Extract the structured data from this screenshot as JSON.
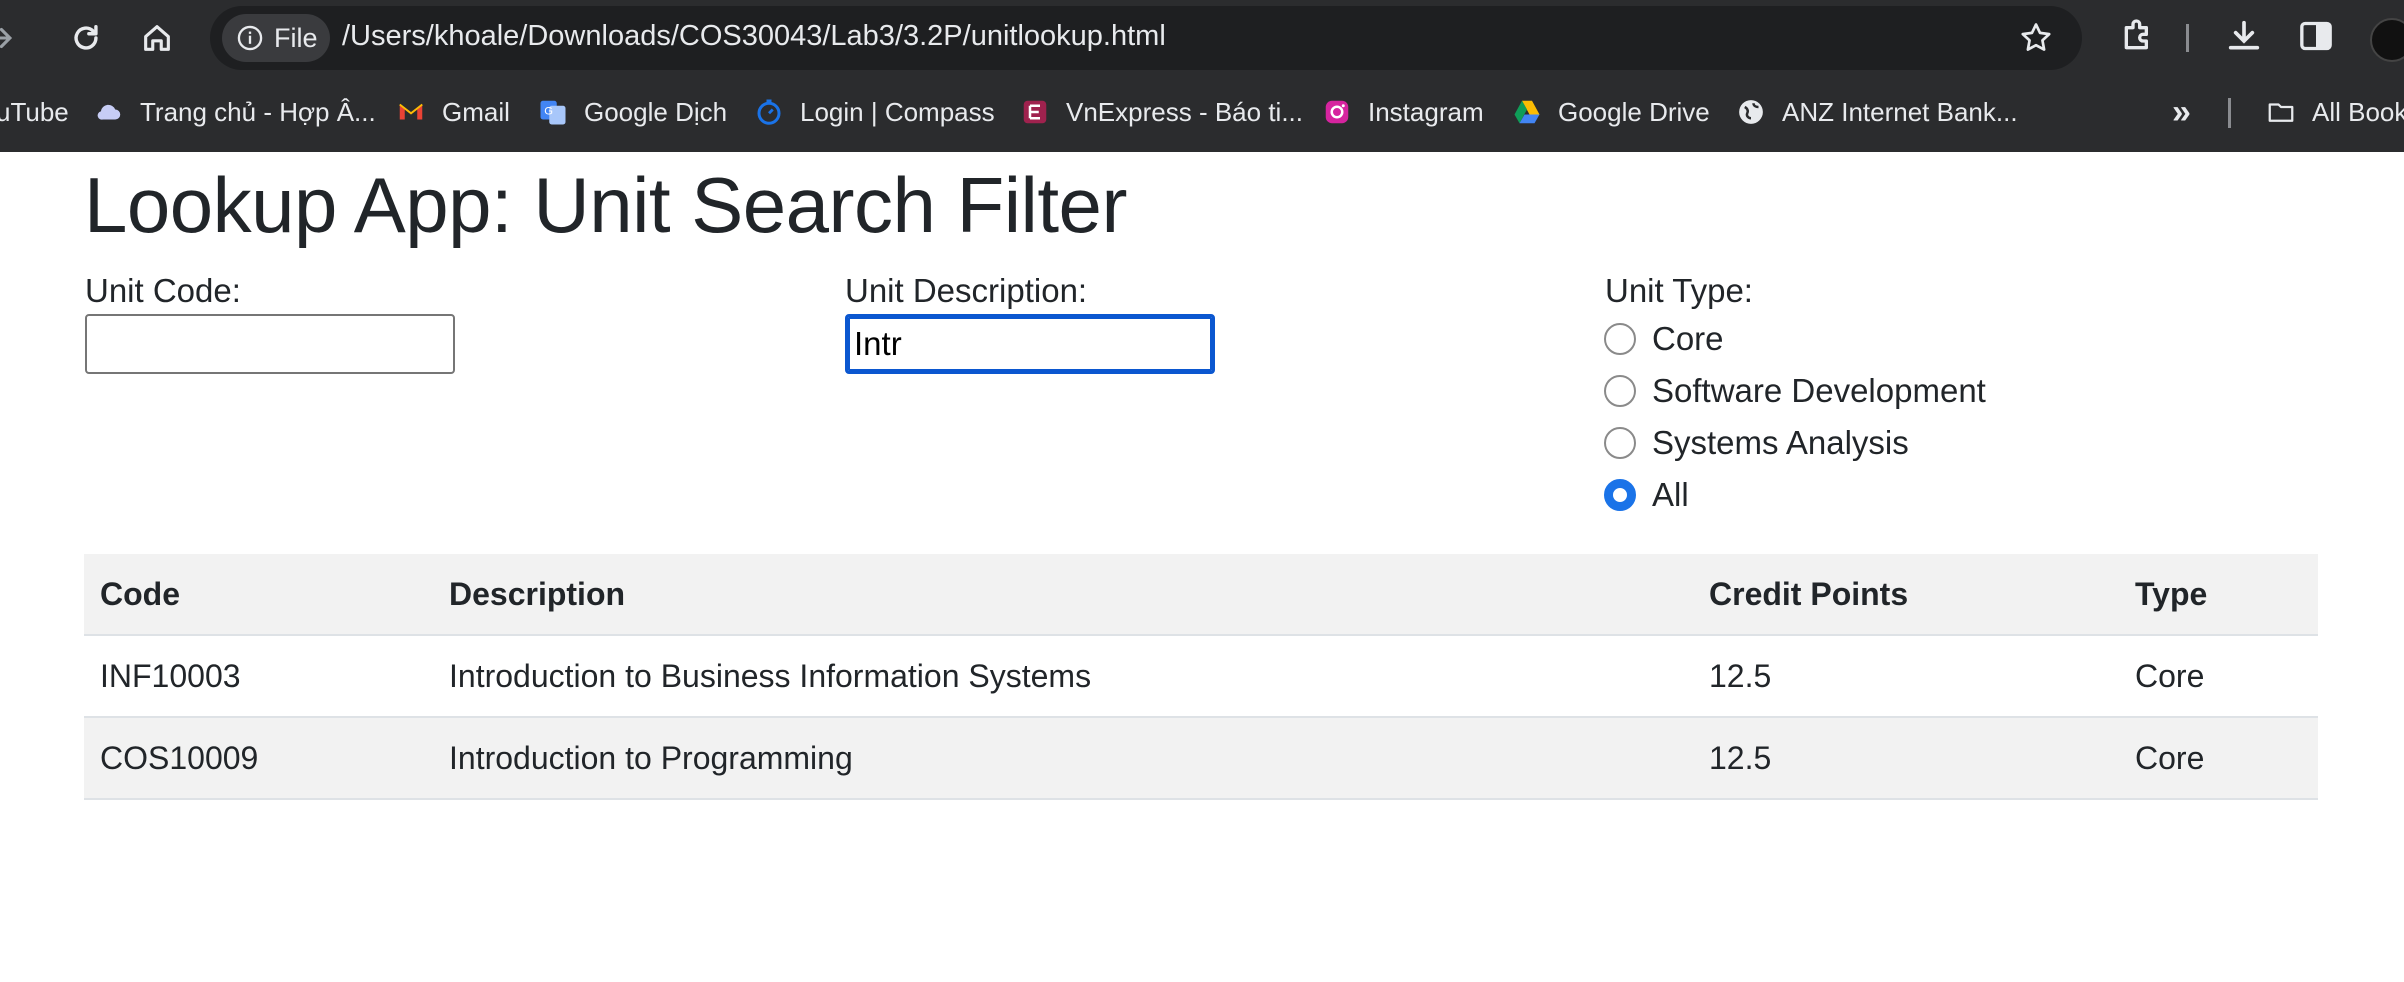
{
  "browser": {
    "site_chip_label": "File",
    "url": "/Users/khoale/Downloads/COS30043/Lab3/3.2P/unitlookup.html",
    "bookmarks": [
      {
        "label": "uTube",
        "icon": "youtube-icon"
      },
      {
        "label": "Trang chủ - Hợp Â...",
        "icon": "cloud-icon"
      },
      {
        "label": "Gmail",
        "icon": "gmail-icon"
      },
      {
        "label": "Google Dịch",
        "icon": "google-translate-icon"
      },
      {
        "label": "Login | Compass",
        "icon": "compass-icon"
      },
      {
        "label": "VnExpress - Báo ti...",
        "icon": "vnexpress-icon"
      },
      {
        "label": "Instagram",
        "icon": "instagram-icon"
      },
      {
        "label": "Google Drive",
        "icon": "google-drive-icon"
      },
      {
        "label": "ANZ Internet Bank...",
        "icon": "globe-icon"
      }
    ],
    "overflow_label": "»",
    "all_bookmarks_label": "All Book"
  },
  "page": {
    "title": "Lookup App: Unit Search Filter",
    "unit_code": {
      "label": "Unit Code:",
      "value": ""
    },
    "unit_description": {
      "label": "Unit Description:",
      "value": "Intr"
    },
    "unit_type": {
      "label": "Unit Type:",
      "options": [
        "Core",
        "Software Development",
        "Systems Analysis",
        "All"
      ],
      "selected": "All"
    },
    "table": {
      "headers": [
        "Code",
        "Description",
        "Credit Points",
        "Type"
      ],
      "rows": [
        [
          "INF10003",
          "Introduction to Business Information Systems",
          "12.5",
          "Core"
        ],
        [
          "COS10009",
          "Introduction to Programming",
          "12.5",
          "Core"
        ]
      ]
    }
  },
  "colors": {
    "chrome_bg": "#2b2c2e",
    "accent": "#1a73e8",
    "focus_border": "#0b57d0",
    "row_stripe": "#f2f2f2"
  }
}
